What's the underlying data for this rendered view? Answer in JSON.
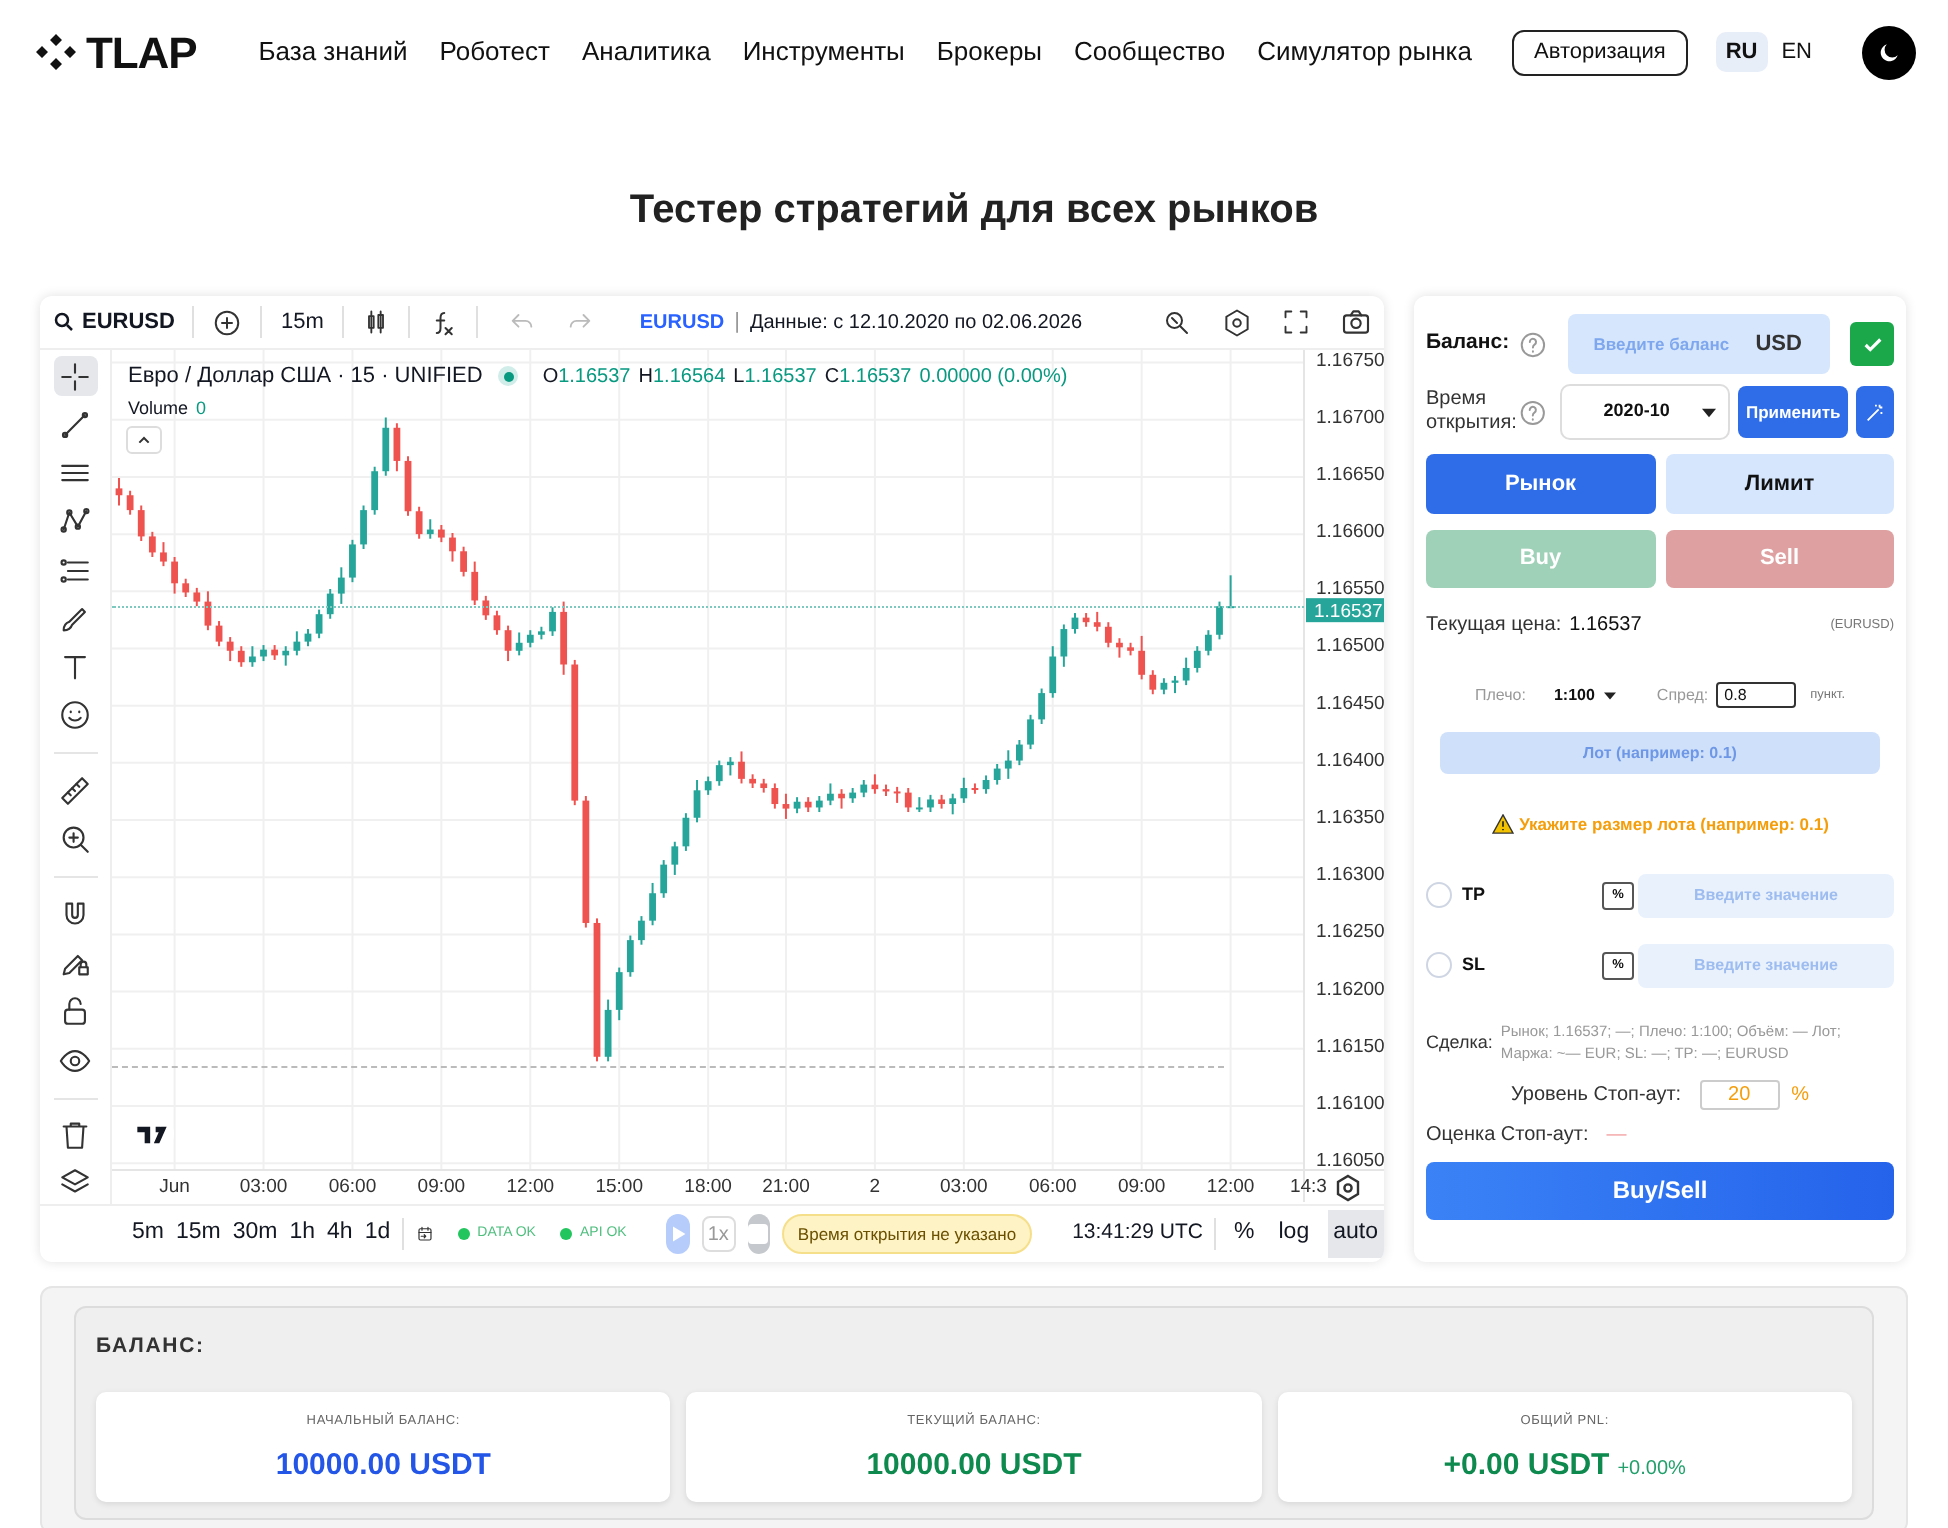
{
  "header": {
    "logo": "TLAP",
    "nav": [
      "База знаний",
      "Роботест",
      "Аналитика",
      "Инструменты",
      "Брокеры",
      "Сообщество",
      "Симулятор рынка"
    ],
    "login": "Авторизация",
    "languages": [
      {
        "label": "RU",
        "selected": true
      },
      {
        "label": "EN",
        "selected": false
      }
    ]
  },
  "title": "Тестер стратегий для всех рынков",
  "chart": {
    "toolbar": {
      "symbol": "EURUSD",
      "interval": "15m",
      "data_symbol": "EURUSD",
      "separator": "|",
      "data_range": "Данные: с 12.10.2020 по 02.06.2026"
    },
    "tools": [
      {
        "kind": "crosshair",
        "selected": true
      },
      {
        "kind": "trend-line",
        "selected": false
      },
      {
        "kind": "horizontal-lines",
        "selected": false
      },
      {
        "kind": "pattern",
        "selected": false
      },
      {
        "kind": "fib",
        "selected": false
      },
      {
        "kind": "brush",
        "selected": false
      },
      {
        "kind": "text",
        "selected": false
      },
      {
        "kind": "emoji",
        "selected": false
      },
      {
        "kind": "ruler",
        "selected": false
      },
      {
        "kind": "zoom",
        "selected": false
      },
      {
        "kind": "magnet",
        "selected": false
      },
      {
        "kind": "pencil-lock",
        "selected": false
      },
      {
        "kind": "lock",
        "selected": false
      },
      {
        "kind": "eye",
        "selected": false
      },
      {
        "kind": "trash",
        "selected": false
      },
      {
        "kind": "layers",
        "selected": false
      }
    ],
    "legend": {
      "title": "Евро / Доллар США · 15 · UNIFIED",
      "ohlc": [
        {
          "key": "O",
          "value": "1.16537"
        },
        {
          "key": "H",
          "value": "1.16564"
        },
        {
          "key": "L",
          "value": "1.16537"
        },
        {
          "key": "C",
          "value": "1.16537"
        }
      ],
      "change": "0.00000 (0.00%)",
      "volume_label": "Volume",
      "volume": "0"
    },
    "chart_data": {
      "type": "candlestick",
      "categories": [
        null,
        null,
        null,
        null,
        null,
        "Jun",
        null,
        null,
        null,
        null,
        null,
        null,
        null,
        "03:00",
        null,
        null,
        null,
        null,
        null,
        null,
        null,
        "06:00",
        null,
        null,
        null,
        null,
        null,
        null,
        null,
        "09:00",
        null,
        null,
        null,
        null,
        null,
        null,
        null,
        "12:00",
        null,
        null,
        null,
        null,
        null,
        null,
        null,
        "15:00",
        null,
        null,
        null,
        null,
        null,
        null,
        null,
        "18:00",
        null,
        null,
        null,
        null,
        null,
        null,
        "21:00",
        null,
        null,
        null,
        null,
        null,
        null,
        null,
        "2",
        null,
        null,
        null,
        null,
        null,
        null,
        null,
        "03:00",
        null,
        null,
        null,
        null,
        null,
        null,
        null,
        "06:00",
        null,
        null,
        null,
        null,
        null,
        null,
        null,
        "09:00",
        null,
        null,
        null,
        null,
        null,
        null,
        null,
        "12:00",
        null,
        null,
        null,
        null,
        null,
        null,
        "14:3"
      ],
      "ohlc": [
        [
          1.1664,
          1.16649,
          1.16625,
          1.16634
        ],
        [
          1.16634,
          1.16638,
          1.16617,
          1.16621
        ],
        [
          1.16621,
          1.16625,
          1.16594,
          1.16598
        ],
        [
          1.16598,
          1.16602,
          1.1658,
          1.16584
        ],
        [
          1.16584,
          1.16593,
          1.16572,
          1.16576
        ],
        [
          1.16576,
          1.1658,
          1.16548,
          1.16557
        ],
        [
          1.16557,
          1.16561,
          1.16545,
          1.16549
        ],
        [
          1.16549,
          1.16553,
          1.16537,
          1.16541
        ],
        [
          1.16541,
          1.1655,
          1.16516,
          1.1652
        ],
        [
          1.1652,
          1.16524,
          1.16502,
          1.16506
        ],
        [
          1.16506,
          1.1651,
          1.16489,
          1.16498
        ],
        [
          1.16498,
          1.16502,
          1.16484,
          1.16488
        ],
        [
          1.16488,
          1.16502,
          1.16484,
          1.16493
        ],
        [
          1.16493,
          1.16503,
          1.16489,
          1.16499
        ],
        [
          1.16499,
          1.16503,
          1.1649,
          1.16494
        ],
        [
          1.16494,
          1.16502,
          1.16485,
          1.16498
        ],
        [
          1.16498,
          1.16515,
          1.16494,
          1.16506
        ],
        [
          1.16506,
          1.16517,
          1.16502,
          1.16513
        ],
        [
          1.16513,
          1.16534,
          1.16509,
          1.1653
        ],
        [
          1.1653,
          1.16552,
          1.16526,
          1.16548
        ],
        [
          1.16548,
          1.16571,
          1.16539,
          1.16562
        ],
        [
          1.16562,
          1.16595,
          1.16558,
          1.16591
        ],
        [
          1.16591,
          1.16625,
          1.16587,
          1.16621
        ],
        [
          1.16621,
          1.16659,
          1.16617,
          1.16655
        ],
        [
          1.16655,
          1.16702,
          1.16651,
          1.16693
        ],
        [
          1.16693,
          1.16697,
          1.16655,
          1.16664
        ],
        [
          1.16664,
          1.16668,
          1.16616,
          1.1662
        ],
        [
          1.1662,
          1.16624,
          1.16596,
          1.166
        ],
        [
          1.166,
          1.16613,
          1.16596,
          1.16604
        ],
        [
          1.16604,
          1.16608,
          1.16593,
          1.16597
        ],
        [
          1.16597,
          1.16601,
          1.16576,
          1.16585
        ],
        [
          1.16585,
          1.16589,
          1.16563,
          1.16567
        ],
        [
          1.16567,
          1.16576,
          1.16538,
          1.16542
        ],
        [
          1.16542,
          1.16546,
          1.16525,
          1.16529
        ],
        [
          1.16529,
          1.16533,
          1.16512,
          1.16516
        ],
        [
          1.16516,
          1.1652,
          1.16489,
          1.16498
        ],
        [
          1.16498,
          1.16514,
          1.16494,
          1.16505
        ],
        [
          1.16505,
          1.16516,
          1.16501,
          1.16512
        ],
        [
          1.16512,
          1.16519,
          1.16508,
          1.16515
        ],
        [
          1.16515,
          1.16536,
          1.16511,
          1.16532
        ],
        [
          1.16532,
          1.16541,
          1.16477,
          1.16486
        ],
        [
          1.16486,
          1.1649,
          1.16363,
          1.16367
        ],
        [
          1.16367,
          1.16371,
          1.16256,
          1.1626
        ],
        [
          1.1626,
          1.16264,
          1.16139,
          1.16143
        ],
        [
          1.16143,
          1.16193,
          1.16139,
          1.16184
        ],
        [
          1.16184,
          1.16221,
          1.16175,
          1.16217
        ],
        [
          1.16217,
          1.16249,
          1.16213,
          1.16245
        ],
        [
          1.16245,
          1.16266,
          1.16241,
          1.16262
        ],
        [
          1.16262,
          1.16295,
          1.16258,
          1.16286
        ],
        [
          1.16286,
          1.16315,
          1.16282,
          1.16311
        ],
        [
          1.16311,
          1.16331,
          1.16302,
          1.16327
        ],
        [
          1.16327,
          1.16356,
          1.16323,
          1.16352
        ],
        [
          1.16352,
          1.16385,
          1.16348,
          1.16376
        ],
        [
          1.16376,
          1.16388,
          1.16372,
          1.16384
        ],
        [
          1.16384,
          1.16402,
          1.1638,
          1.16398
        ],
        [
          1.16398,
          1.16405,
          1.16389,
          1.16401
        ],
        [
          1.16401,
          1.1641,
          1.16382,
          1.16386
        ],
        [
          1.16386,
          1.1639,
          1.16378,
          1.16382
        ],
        [
          1.16382,
          1.16386,
          1.16374,
          1.16378
        ],
        [
          1.16378,
          1.16382,
          1.1636,
          1.16364
        ],
        [
          1.16364,
          1.16373,
          1.16351,
          1.1636
        ],
        [
          1.1636,
          1.1637,
          1.16356,
          1.16366
        ],
        [
          1.16366,
          1.1637,
          1.16357,
          1.16361
        ],
        [
          1.16361,
          1.16371,
          1.16357,
          1.16367
        ],
        [
          1.16367,
          1.16382,
          1.16363,
          1.16373
        ],
        [
          1.16373,
          1.16377,
          1.1636,
          1.16369
        ],
        [
          1.16369,
          1.16378,
          1.16365,
          1.16374
        ],
        [
          1.16374,
          1.16385,
          1.1637,
          1.16381
        ],
        [
          1.16381,
          1.1639,
          1.16373,
          1.16377
        ],
        [
          1.16377,
          1.16381,
          1.16371,
          1.16375
        ],
        [
          1.16375,
          1.16379,
          1.16365,
          1.16374
        ],
        [
          1.16374,
          1.16378,
          1.16357,
          1.16361
        ],
        [
          1.16361,
          1.1637,
          1.16357,
          1.16361
        ],
        [
          1.16361,
          1.16372,
          1.16357,
          1.16368
        ],
        [
          1.16368,
          1.16372,
          1.1636,
          1.16364
        ],
        [
          1.16364,
          1.16373,
          1.16355,
          1.16369
        ],
        [
          1.16369,
          1.16387,
          1.16365,
          1.16378
        ],
        [
          1.16378,
          1.16382,
          1.16373,
          1.16377
        ],
        [
          1.16377,
          1.16389,
          1.16373,
          1.16385
        ],
        [
          1.16385,
          1.16399,
          1.16381,
          1.16395
        ],
        [
          1.16395,
          1.16411,
          1.16386,
          1.16402
        ],
        [
          1.16402,
          1.1642,
          1.16398,
          1.16416
        ],
        [
          1.16416,
          1.16442,
          1.16412,
          1.16438
        ],
        [
          1.16438,
          1.16465,
          1.16434,
          1.16461
        ],
        [
          1.16461,
          1.16502,
          1.16457,
          1.16493
        ],
        [
          1.16493,
          1.16521,
          1.16484,
          1.16517
        ],
        [
          1.16517,
          1.16531,
          1.16513,
          1.16527
        ],
        [
          1.16527,
          1.16531,
          1.16519,
          1.16523
        ],
        [
          1.16523,
          1.16532,
          1.16515,
          1.16519
        ],
        [
          1.16519,
          1.16523,
          1.16501,
          1.16505
        ],
        [
          1.16505,
          1.16509,
          1.16492,
          1.16501
        ],
        [
          1.16501,
          1.16505,
          1.16494,
          1.16498
        ],
        [
          1.16498,
          1.16511,
          1.16473,
          1.16477
        ],
        [
          1.16477,
          1.16481,
          1.1646,
          1.16464
        ],
        [
          1.16464,
          1.16474,
          1.1646,
          1.1647
        ],
        [
          1.1647,
          1.16476,
          1.16461,
          1.16472
        ],
        [
          1.16472,
          1.16492,
          1.16468,
          1.16483
        ],
        [
          1.16483,
          1.16502,
          1.16479,
          1.16498
        ],
        [
          1.16498,
          1.16516,
          1.16494,
          1.16512
        ],
        [
          1.16512,
          1.16541,
          1.16508,
          1.16537
        ],
        [
          1.16537,
          1.16564,
          1.16537,
          1.16537
        ],
        null,
        null,
        null,
        null,
        null,
        null,
        null
      ],
      "ylim": [
        1.16044,
        1.16761
      ],
      "grid": true,
      "yticks": [
        {
          "value": 1.1675,
          "label": "1.16750"
        },
        {
          "value": 1.167,
          "label": "1.16700"
        },
        {
          "value": 1.1665,
          "label": "1.16650"
        },
        {
          "value": 1.166,
          "label": "1.16600"
        },
        {
          "value": 1.1655,
          "label": "1.16550"
        },
        {
          "value": 1.165,
          "label": "1.16500"
        },
        {
          "value": 1.1645,
          "label": "1.16450"
        },
        {
          "value": 1.164,
          "label": "1.16400"
        },
        {
          "value": 1.1635,
          "label": "1.16350"
        },
        {
          "value": 1.163,
          "label": "1.16300"
        },
        {
          "value": 1.1625,
          "label": "1.16250"
        },
        {
          "value": 1.162,
          "label": "1.16200"
        },
        {
          "value": 1.1615,
          "label": "1.16150"
        },
        {
          "value": 1.161,
          "label": "1.16100"
        },
        {
          "value": 1.1605,
          "label": "1.16050"
        }
      ]
    },
    "current_price": "1.16537",
    "timeframes": [
      "5m",
      "15m",
      "30m",
      "1h",
      "4h",
      "1d"
    ],
    "statuses": [
      {
        "label": "DATA OK",
        "color": "#22c55e"
      },
      {
        "label": "API OK",
        "color": "#22c55e"
      }
    ],
    "speed": "1x",
    "badge": "Время открытия не указано",
    "clock": "13:41:29 UTC",
    "scale_buttons": [
      {
        "label": "%",
        "selected": false
      },
      {
        "label": "log",
        "selected": false
      },
      {
        "label": "auto",
        "selected": true
      }
    ]
  },
  "panel": {
    "balance": {
      "label": "Баланс:",
      "placeholder": "Введите баланс",
      "currency": "USD"
    },
    "open_time": {
      "label": "Время открытия:",
      "value": "2020-10",
      "apply": "Применить"
    },
    "order_types": [
      {
        "label": "Рынок",
        "selected": true
      },
      {
        "label": "Лимит",
        "selected": false
      }
    ],
    "sides": [
      {
        "kind": "buy",
        "label": "Buy",
        "disabled": true
      },
      {
        "kind": "sell",
        "label": "Sell",
        "disabled": true
      }
    ],
    "current_price": {
      "label": "Текущая цена:",
      "value": "1.16537",
      "symbol": "(EURUSD)"
    },
    "leverage": {
      "label": "Плечо:",
      "value": "1:100"
    },
    "spread": {
      "label": "Спред:",
      "value": "0.8",
      "unit": "пункт."
    },
    "lot": {
      "placeholder": "Лот (например: 0.1)"
    },
    "warning": "Укажите размер лота (например: 0.1)",
    "targets": [
      {
        "label": "TP",
        "checked": false,
        "unit": "%",
        "placeholder": "Введите значение"
      },
      {
        "label": "SL",
        "checked": false,
        "unit": "%",
        "placeholder": "Введите значение"
      }
    ],
    "deal": {
      "label": "Сделка:",
      "text": "Рынок; 1.16537; —; Плечо: 1:100; Объём: — Лот; Маржа: ~— EUR; SL: —; TP: —; EURUSD"
    },
    "stopout_level": {
      "label": "Уровень Стоп-аут:",
      "value": "20",
      "unit": "%"
    },
    "stopout_estimate": {
      "label": "Оценка Стоп-аут:",
      "value": "—"
    },
    "submit": "Buy/Sell"
  },
  "balance": {
    "title": "БАЛАНС:",
    "cards": [
      {
        "label": "НАЧАЛЬНЫЙ БАЛАНС:",
        "value": "10000.00 USDT",
        "color": "#2355e6"
      },
      {
        "label": "ТЕКУЩИЙ БАЛАНС:",
        "value": "10000.00 USDT",
        "color": "#0f8a4f"
      },
      {
        "label": "ОБЩИЙ PNL:",
        "value": "+0.00 USDT",
        "change": "+0.00%",
        "color": "#0f8a4f"
      }
    ]
  }
}
